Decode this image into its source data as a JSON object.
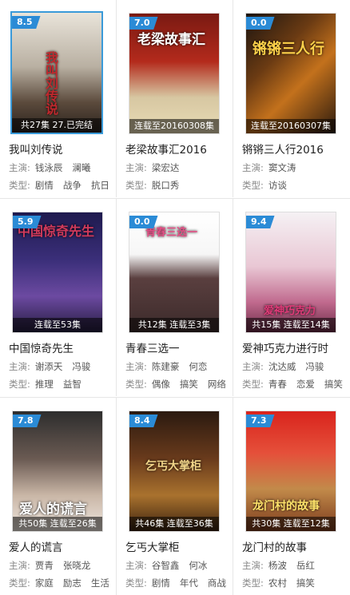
{
  "cards": [
    {
      "score": "8.5",
      "status": "共27集 27.已完结",
      "title": "我叫刘传说",
      "actors": [
        "钱泳辰",
        "澜曦"
      ],
      "genres": [
        "剧情",
        "战争",
        "抗日"
      ],
      "poster_text": "我叫刘传说"
    },
    {
      "score": "7.0",
      "status": "连载至20160308集",
      "title": "老梁故事汇2016",
      "actors": [
        "梁宏达"
      ],
      "genres": [
        "脱口秀"
      ],
      "poster_text": "老梁故事汇"
    },
    {
      "score": "0.0",
      "status": "连载至20160307集",
      "title": "锵锵三人行2016",
      "actors": [
        "窦文涛"
      ],
      "genres": [
        "访谈"
      ],
      "poster_text": "锵锵三人行"
    },
    {
      "score": "5.9",
      "status": "连载至53集",
      "title": "中国惊奇先生",
      "actors": [
        "谢添天",
        "冯骏"
      ],
      "genres": [
        "推理",
        "益智"
      ],
      "poster_text": "中国惊奇先生"
    },
    {
      "score": "0.0",
      "status": "共12集 连载至3集",
      "title": "青春三选一",
      "actors": [
        "陈建豪",
        "何恋"
      ],
      "genres": [
        "偶像",
        "搞笑",
        "网络"
      ],
      "poster_text": "青春三选一"
    },
    {
      "score": "9.4",
      "status": "共15集 连载至14集",
      "title": "爱神巧克力进行时",
      "actors": [
        "沈达威",
        "冯骏"
      ],
      "genres": [
        "青春",
        "恋爱",
        "搞笑"
      ],
      "poster_text": "爱神巧克力"
    },
    {
      "score": "7.8",
      "status": "共50集 连载至26集",
      "title": "爱人的谎言",
      "actors": [
        "贾青",
        "张晓龙"
      ],
      "genres": [
        "家庭",
        "励志",
        "生活"
      ],
      "poster_text": "爱人的谎言"
    },
    {
      "score": "8.4",
      "status": "共46集 连载至36集",
      "title": "乞丐大掌柜",
      "actors": [
        "谷智鑫",
        "何冰"
      ],
      "genres": [
        "剧情",
        "年代",
        "商战"
      ],
      "poster_text": "乞丐大掌柜"
    },
    {
      "score": "7.3",
      "status": "共30集 连载至12集",
      "title": "龙门村的故事",
      "actors": [
        "杨波",
        "岳红"
      ],
      "genres": [
        "农村",
        "搞笑"
      ],
      "poster_text": "龙门村的故事"
    }
  ],
  "labels": {
    "actors": "主演:",
    "genre": "类型:"
  },
  "colors": {
    "badge": "#2b8bd6",
    "selected_border": "#3a9ad9"
  }
}
